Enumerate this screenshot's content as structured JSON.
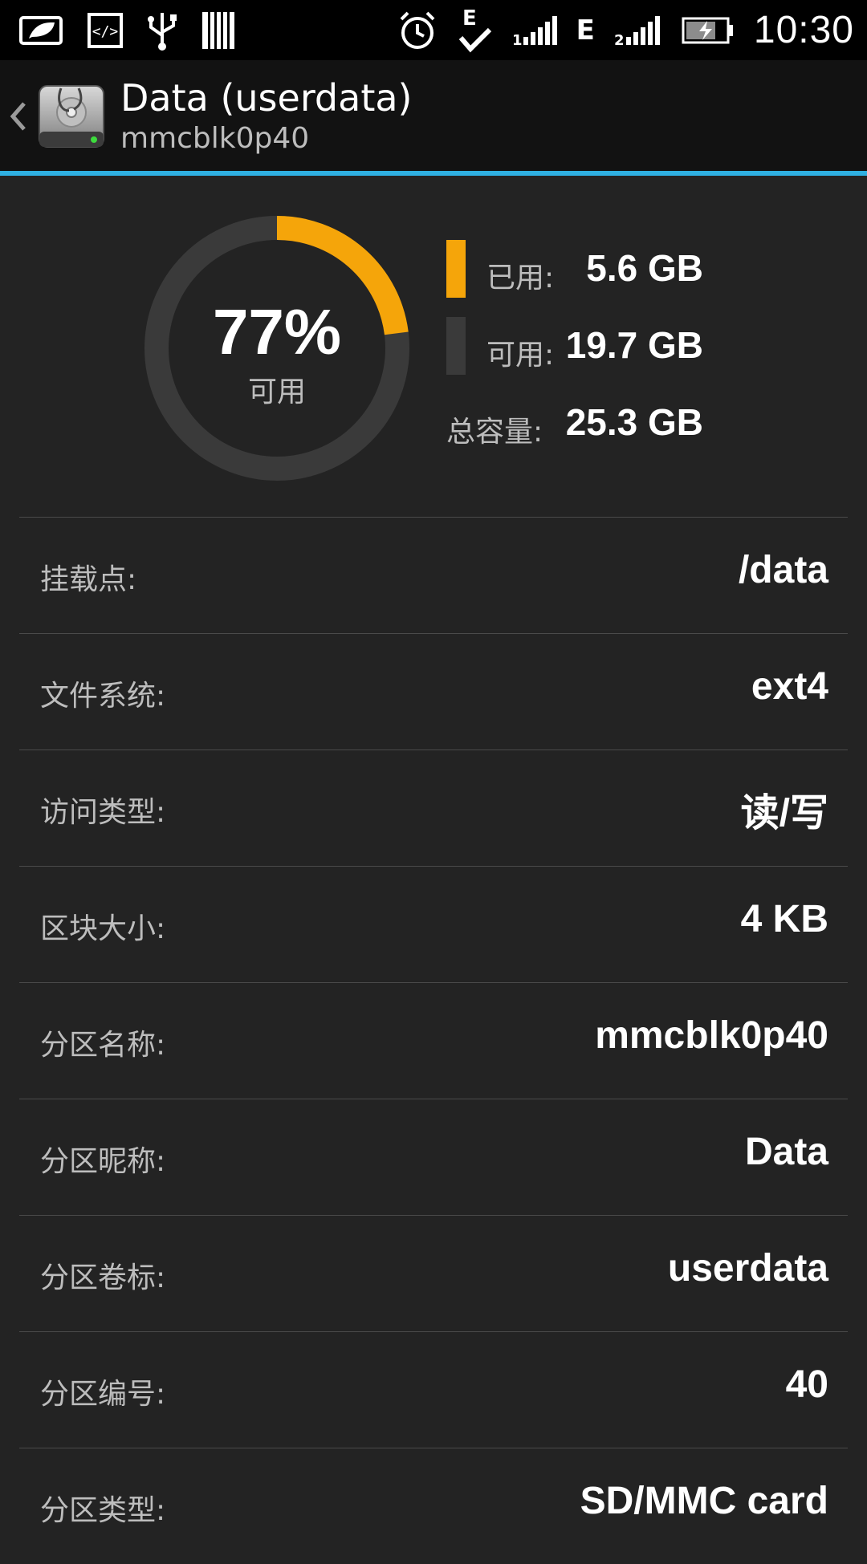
{
  "status_bar": {
    "time": "10:30",
    "network_type_1": "E",
    "network_type_2": "E",
    "icons": [
      "eco-battery-icon",
      "developer-code-icon",
      "usb-icon",
      "barcode-icon",
      "alarm-clock-icon",
      "e-check-icon",
      "signal-1-icon",
      "signal-2-icon",
      "battery-charging-icon"
    ]
  },
  "header": {
    "title": "Data (userdata)",
    "subtitle": "mmcblk0p40",
    "app_icon": "disk-stethoscope-icon",
    "accent_color": "#2fb0e2"
  },
  "usage": {
    "percent_label": "77%",
    "percent_caption": "可用",
    "available_fraction": 0.77,
    "used_color": "#f5a50a",
    "free_color": "#3a3a3a",
    "used_label": "已用:",
    "used_value": "5.6 GB",
    "free_label": "可用:",
    "free_value": "19.7 GB",
    "total_label": "总容量:",
    "total_value": "25.3 GB"
  },
  "details": [
    {
      "label": "挂载点:",
      "value": "/data"
    },
    {
      "label": "文件系统:",
      "value": "ext4"
    },
    {
      "label": "访问类型:",
      "value": "读/写"
    },
    {
      "label": "区块大小:",
      "value": "4 KB"
    },
    {
      "label": "分区名称:",
      "value": "mmcblk0p40"
    },
    {
      "label": "分区昵称:",
      "value": "Data"
    },
    {
      "label": "分区卷标:",
      "value": "userdata"
    },
    {
      "label": "分区编号:",
      "value": "40"
    },
    {
      "label": "分区类型:",
      "value": "SD/MMC card"
    }
  ]
}
